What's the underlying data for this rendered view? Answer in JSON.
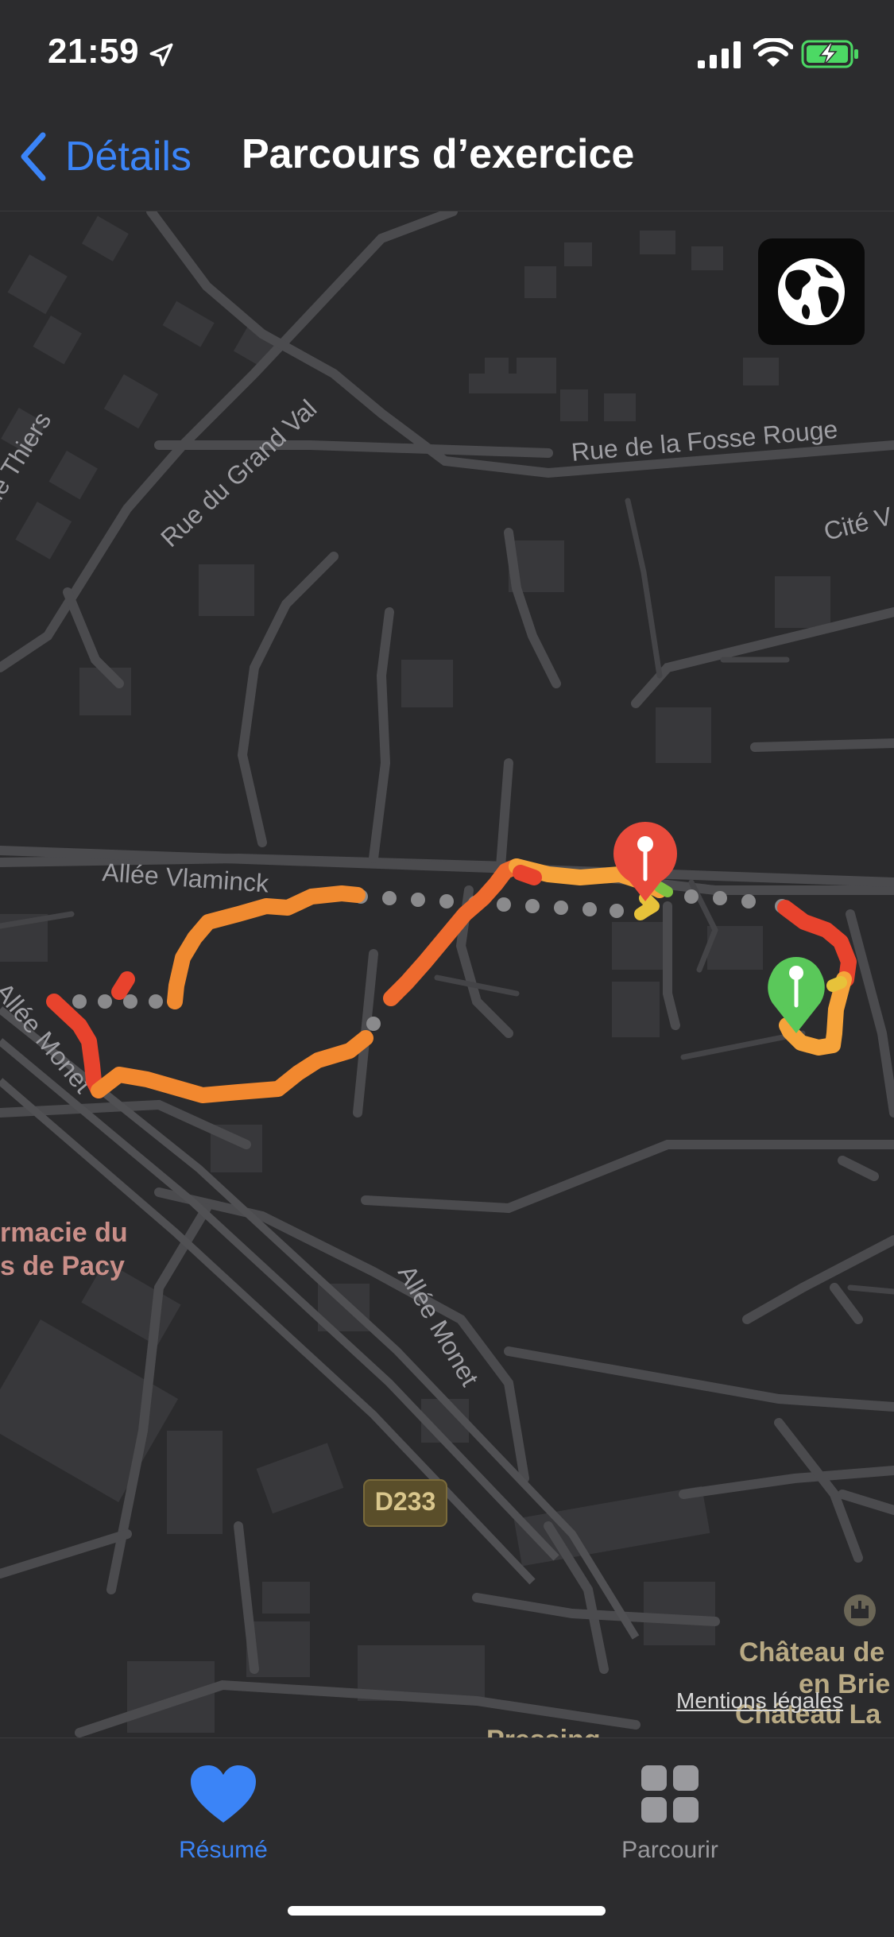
{
  "status_bar": {
    "time": "21:59"
  },
  "nav": {
    "back_label": "Détails",
    "title": "Parcours d’exercice"
  },
  "map": {
    "streets": [
      "Rue de la Fosse Rouge",
      "Rue du Grand Val",
      "Cité V",
      "ue Thiers",
      "Allée Vlaminck",
      "Allée Monet",
      "Allée Monet",
      "D233"
    ],
    "pois": [
      "rmacie du",
      "s de Pacy",
      "Château de",
      "en Brie",
      "Château La",
      "Pressing"
    ],
    "legal_link": "Mentions légales",
    "colors": {
      "route_fast": "#f6a33a",
      "route_slow": "#e8432d",
      "start_pin": "#5ac85a",
      "end_pin": "#e94b3c",
      "paused_dots": "#8a8a8c"
    }
  },
  "tabs": [
    {
      "label": "Résumé",
      "icon": "heart-icon",
      "selected": true
    },
    {
      "label": "Parcourir",
      "icon": "grid-icon",
      "selected": false
    }
  ]
}
